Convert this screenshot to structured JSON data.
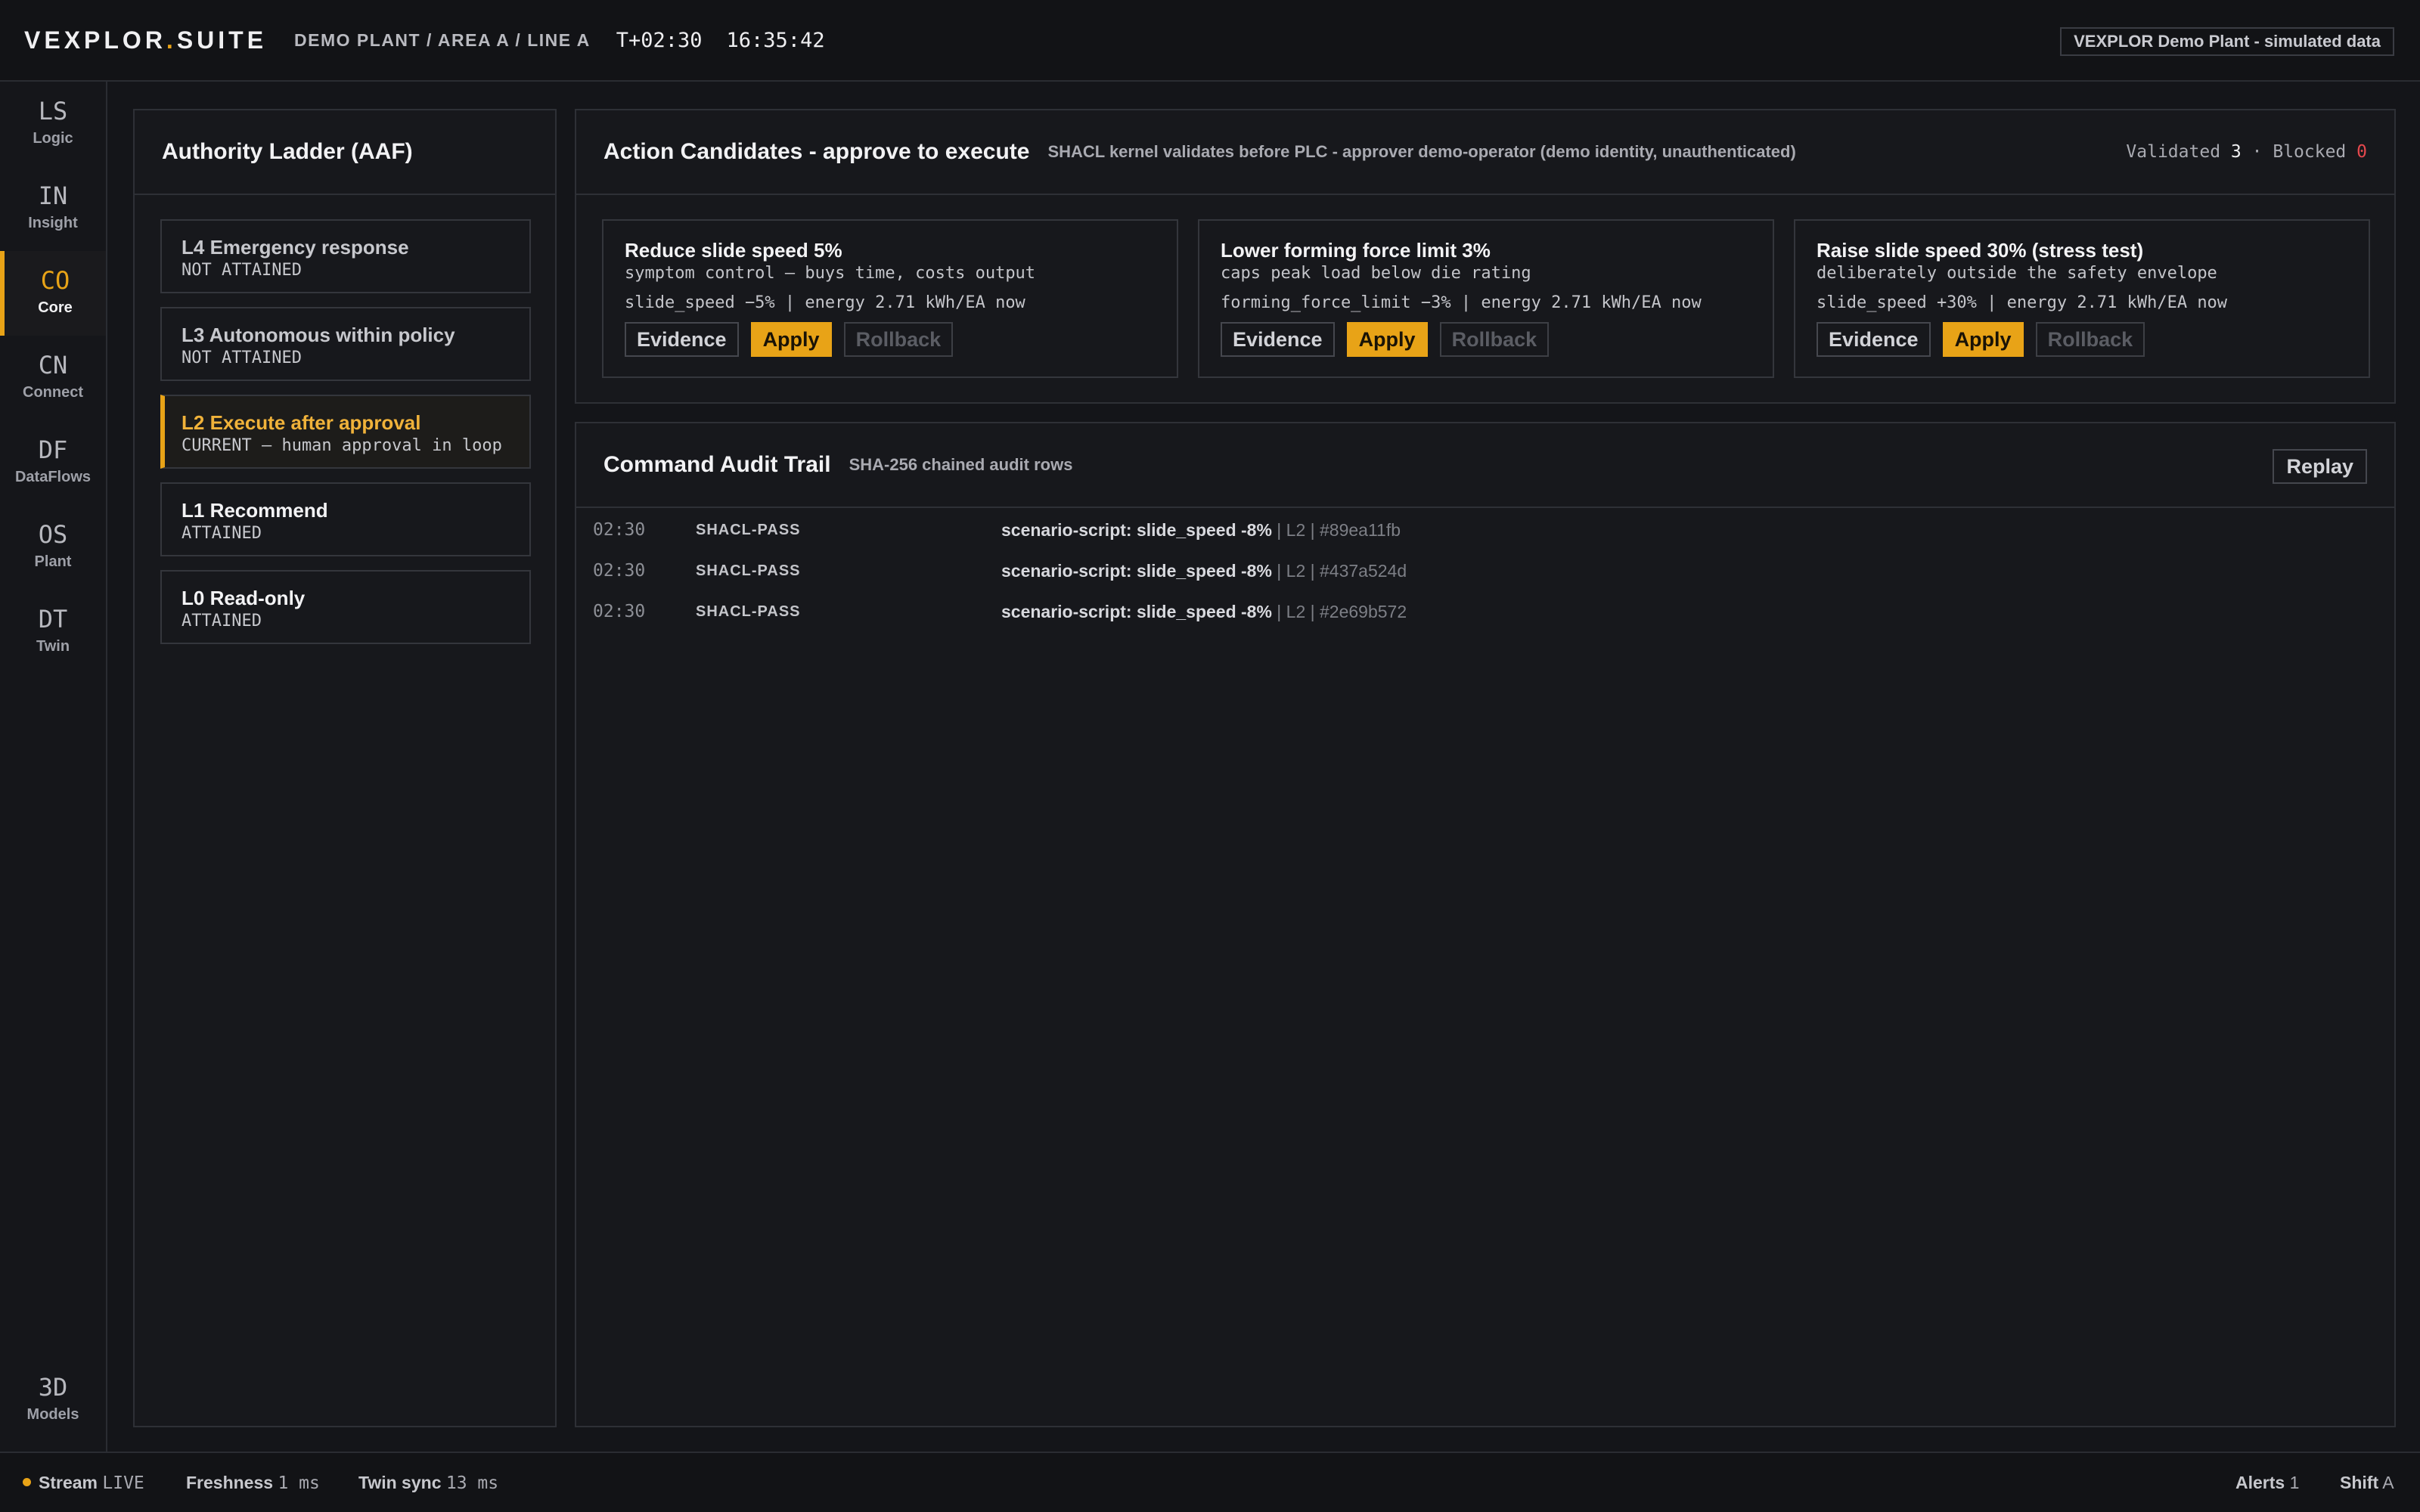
{
  "topbar": {
    "brand_a": "VEXPLOR",
    "brand_dot": ".",
    "brand_b": "SUITE",
    "breadcrumb": "DEMO PLANT / AREA A / LINE A",
    "t_offset": "T+02:30",
    "clock": "16:35:42",
    "demo_badge": "VEXPLOR Demo Plant - simulated data"
  },
  "rail": {
    "items": [
      {
        "code": "LS",
        "label": "Logic",
        "icon": "logic-icon"
      },
      {
        "code": "IN",
        "label": "Insight",
        "icon": "insight-icon"
      },
      {
        "code": "CO",
        "label": "Core",
        "icon": "core-icon",
        "active": true
      },
      {
        "code": "CN",
        "label": "Connect",
        "icon": "connect-icon"
      },
      {
        "code": "DF",
        "label": "DataFlows",
        "icon": "dataflows-icon"
      },
      {
        "code": "OS",
        "label": "Plant",
        "icon": "plant-icon"
      },
      {
        "code": "DT",
        "label": "Twin",
        "icon": "twin-icon"
      }
    ],
    "bottom": {
      "code": "3D",
      "label": "Models",
      "icon": "models-icon"
    }
  },
  "ladder": {
    "title": "Authority Ladder (AAF)",
    "levels": [
      {
        "title": "L4 Emergency response",
        "status": "NOT ATTAINED"
      },
      {
        "title": "L3 Autonomous within policy",
        "status": "NOT ATTAINED"
      },
      {
        "title": "L2 Execute after approval",
        "status": "CURRENT — human approval in loop"
      },
      {
        "title": "L1 Recommend",
        "status": "ATTAINED"
      },
      {
        "title": "L0 Read-only",
        "status": "ATTAINED"
      }
    ]
  },
  "actions": {
    "title": "Action Candidates - approve to execute",
    "subtitle": "SHACL kernel validates before PLC - approver demo-operator (demo identity, unauthenticated)",
    "validated_label": "Validated",
    "validated_count": "3",
    "sep": "·",
    "blocked_label": "Blocked",
    "blocked_count": "0",
    "cards": [
      {
        "title": "Reduce slide speed 5%",
        "subtitle": "symptom control — buys time, costs output",
        "metric": "slide_speed −5% | energy 2.71 kWh/EA now"
      },
      {
        "title": "Lower forming force limit 3%",
        "subtitle": "caps peak load below die rating",
        "metric": "forming_force_limit −3% | energy 2.71 kWh/EA now"
      },
      {
        "title": "Raise slide speed 30% (stress test)",
        "subtitle": "deliberately outside the safety envelope",
        "metric": "slide_speed +30% | energy 2.71 kWh/EA now"
      }
    ],
    "buttons": {
      "evidence": "Evidence",
      "apply": "Apply",
      "rollback": "Rollback"
    }
  },
  "audit": {
    "title": "Command Audit Trail",
    "subtitle": "SHA-256 chained audit rows",
    "replay_label": "Replay",
    "rows": [
      {
        "time": "02:30",
        "event": "SHACL-PASS",
        "desc": "scenario-script: slide_speed -8%",
        "meta": " | L2 | #89ea11fb"
      },
      {
        "time": "02:30",
        "event": "SHACL-PASS",
        "desc": "scenario-script: slide_speed -8%",
        "meta": " | L2 | #437a524d"
      },
      {
        "time": "02:30",
        "event": "SHACL-PASS",
        "desc": "scenario-script: slide_speed -8%",
        "meta": " | L2 | #2e69b572"
      }
    ]
  },
  "status": {
    "stream_label": "Stream",
    "stream_value": "LIVE",
    "freshness_label": "Freshness",
    "freshness_value": "1 ms",
    "twin_label": "Twin sync",
    "twin_value": "13 ms",
    "alerts_label": "Alerts",
    "alerts_value": "1",
    "shift_label": "Shift",
    "shift_value": "A"
  },
  "colors": {
    "accent": "#e8a317",
    "danger": "#e5484d",
    "background": "#141519"
  }
}
